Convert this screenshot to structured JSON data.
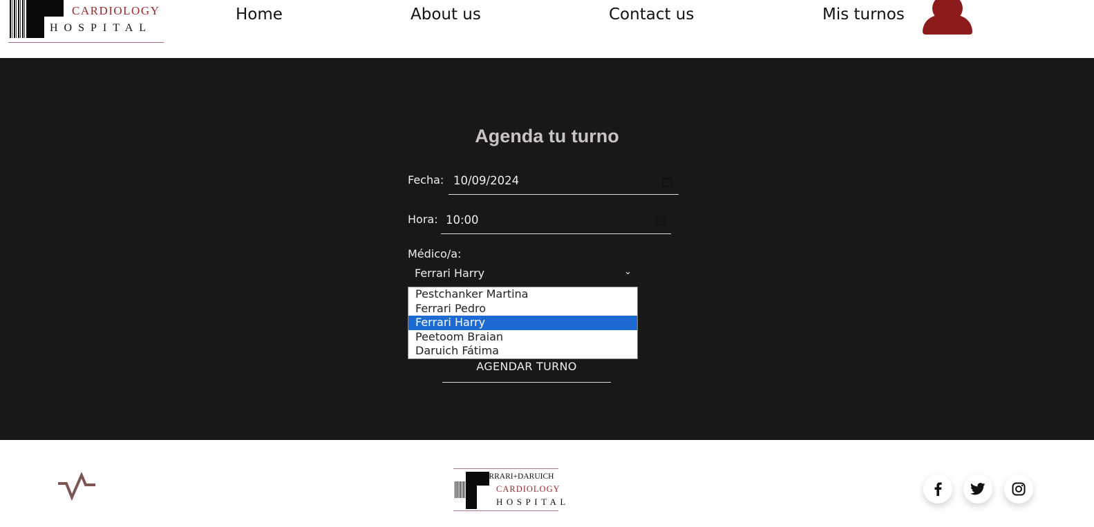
{
  "header": {
    "logo": {
      "line1": "CARDIOLOGY",
      "line2": "HOSPITAL"
    },
    "nav": [
      {
        "label": "Home"
      },
      {
        "label": "About us"
      },
      {
        "label": "Contact us"
      },
      {
        "label": "Mis turnos"
      }
    ],
    "avatar_icon": "user-silhouette-icon",
    "accent_color": "#8e1b1b"
  },
  "form": {
    "title": "Agenda tu turno",
    "fecha_label": "Fecha:",
    "fecha_value": "10/09/2024",
    "hora_label": "Hora:",
    "hora_value": "10:00",
    "medico_label": "Médico/a:",
    "medico_selected": "Ferrari Harry",
    "medico_options": [
      "Pestchanker Martina",
      "Ferrari Pedro",
      "Ferrari Harry",
      "Peetoom Braian",
      "Daruich Fátima"
    ],
    "selected_index": 2,
    "submit_label": "AGENDAR TURNO"
  },
  "footer": {
    "logo": {
      "line1": "FERRARI+DARUICH",
      "line2": "CARDIOLOGY",
      "line3": "HOSPITAL"
    },
    "pulse_icon": "heartbeat-icon",
    "social": [
      "facebook-icon",
      "twitter-icon",
      "instagram-icon"
    ]
  }
}
